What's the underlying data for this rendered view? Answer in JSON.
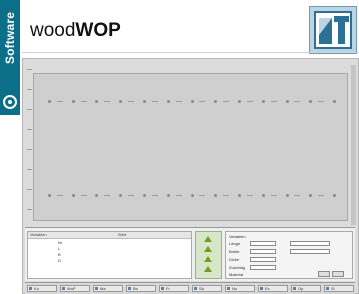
{
  "brochure": {
    "section_label": "Software",
    "title_prefix": "wood",
    "title_bold": "WOP",
    "logo_icon": "homag-logo-icon"
  },
  "app": {
    "left_panel": {
      "col1": "Variablen",
      "col2": "Wert",
      "rows": [
        "Nr",
        "L",
        "B",
        "D"
      ]
    },
    "params": {
      "labels": [
        "Variablen",
        "Länge",
        "Breite",
        "Dicke",
        "Zuschlag",
        "Material"
      ],
      "buttons": [
        "OK",
        "Abbr."
      ]
    },
    "taskbar_items": [
      "Ko",
      "WoP",
      "Ma",
      "Bo",
      "Fr",
      "Sä",
      "Nu",
      "Ex",
      "Op",
      "Si"
    ]
  }
}
